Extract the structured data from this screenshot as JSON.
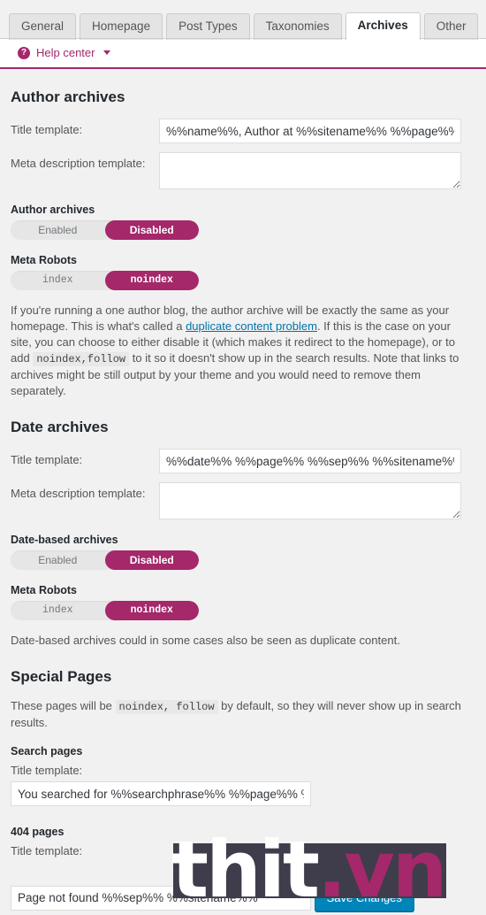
{
  "tabs": [
    {
      "label": "General",
      "active": false
    },
    {
      "label": "Homepage",
      "active": false
    },
    {
      "label": "Post Types",
      "active": false
    },
    {
      "label": "Taxonomies",
      "active": false
    },
    {
      "label": "Archives",
      "active": true
    },
    {
      "label": "Other",
      "active": false
    }
  ],
  "help": {
    "icon": "question-circle-icon",
    "label": "Help center",
    "caret": "chevron-down-icon",
    "accent": "#a4286a"
  },
  "author_archives": {
    "heading": "Author archives",
    "title_label": "Title template:",
    "title_value": "%%name%%, Author at %%sitename%% %%page%%",
    "meta_label": "Meta description template:",
    "meta_value": "",
    "meta_placeholder": "",
    "toggle1": {
      "title": "Author archives",
      "left": "Enabled",
      "right": "Disabled",
      "selected": "Disabled"
    },
    "toggle2": {
      "title": "Meta Robots",
      "left": "index",
      "right": "noindex",
      "selected": "noindex"
    },
    "note_1": "If you're running a one author blog, the author archive will be exactly the same as your homepage. This is what's called a ",
    "note_link": "duplicate content problem",
    "note_2": ". If this is the case on your site, you can choose to either disable it (which makes it redirect to the homepage), or to add ",
    "note_code": "noindex,follow",
    "note_3": " to it so it doesn't show up in the search results. Note that links to archives might be still output by your theme and you would need to remove them separately."
  },
  "date_archives": {
    "heading": "Date archives",
    "title_label": "Title template:",
    "title_value": "%%date%% %%page%% %%sep%% %%sitename%%",
    "meta_label": "Meta description template:",
    "meta_value": "",
    "toggle1": {
      "title": "Date-based archives",
      "left": "Enabled",
      "right": "Disabled",
      "selected": "Disabled"
    },
    "toggle2": {
      "title": "Meta Robots",
      "left": "index",
      "right": "noindex",
      "selected": "noindex"
    },
    "note": "Date-based archives could in some cases also be seen as duplicate content."
  },
  "special_pages": {
    "heading": "Special Pages",
    "note_1": "These pages will be ",
    "note_code": "noindex, follow",
    "note_2": " by default, so they will never show up in search results.",
    "search": {
      "sub_title": "Search pages",
      "title_label": "Title template:",
      "title_value": "You searched for %%searchphrase%% %%page%% %%sep%%"
    },
    "notfound": {
      "sub_title": "404 pages",
      "title_label": "Title template:",
      "title_value": "Page not found %%sep%% %%sitename%%"
    }
  },
  "footer": {
    "save_label": "Save Changes",
    "save_color": "#0085ba"
  },
  "watermark": {
    "text_white": "thit",
    "text_accent": ".vn",
    "box_color": "#3f3d4b",
    "accent_color": "#a4286a"
  }
}
